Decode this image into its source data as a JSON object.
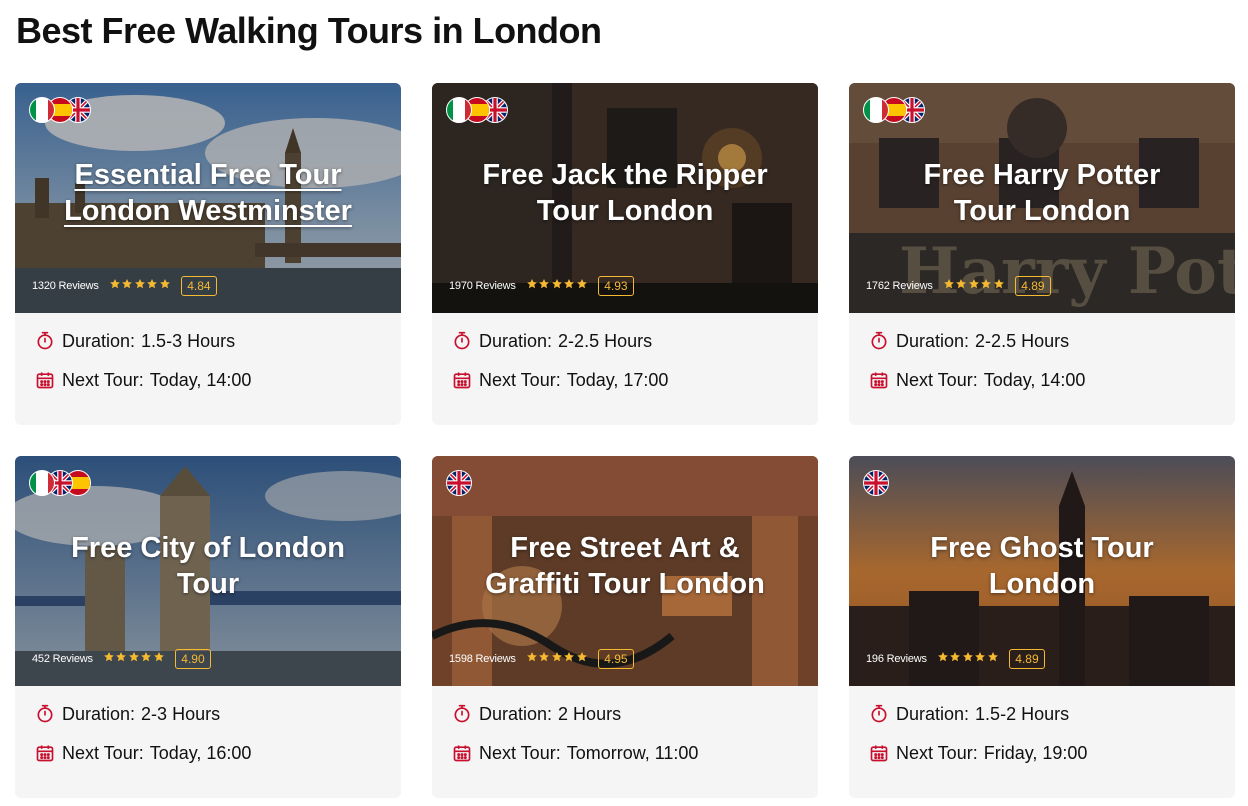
{
  "page_title": "Best Free Walking Tours in London",
  "colors": {
    "accent_red": "#c8102e",
    "rating_gold": "#f5b932",
    "card_bg": "#f5f5f5"
  },
  "labels": {
    "duration": "Duration:",
    "next_tour": "Next Tour:"
  },
  "tours": [
    {
      "title": "Essential Free Tour London Westminster",
      "underlined": true,
      "flags": [
        "italy-flag-icon",
        "spain-flag-icon",
        "uk-flag-icon"
      ],
      "reviews": "1320 Reviews",
      "rating": "4.84",
      "duration": "1.5-3 Hours",
      "next_tour": "Today, 14:00",
      "scene": "westminster"
    },
    {
      "title": "Free Jack the Ripper Tour London",
      "underlined": false,
      "flags": [
        "italy-flag-icon",
        "spain-flag-icon",
        "uk-flag-icon"
      ],
      "reviews": "1970 Reviews",
      "rating": "4.93",
      "duration": "2-2.5 Hours",
      "next_tour": "Today, 17:00",
      "scene": "ripper"
    },
    {
      "title": "Free Harry Potter Tour London",
      "underlined": false,
      "flags": [
        "italy-flag-icon",
        "spain-flag-icon",
        "uk-flag-icon"
      ],
      "reviews": "1762 Reviews",
      "rating": "4.89",
      "duration": "2-2.5 Hours",
      "next_tour": "Today, 14:00",
      "scene": "potter"
    },
    {
      "title": "Free City of London Tour",
      "underlined": false,
      "flags": [
        "italy-flag-icon",
        "uk-flag-icon",
        "spain-flag-icon"
      ],
      "reviews": "452 Reviews",
      "rating": "4.90",
      "duration": "2-3 Hours",
      "next_tour": "Today, 16:00",
      "scene": "towerbridge"
    },
    {
      "title": "Free Street Art & Graffiti Tour London",
      "underlined": false,
      "flags": [
        "uk-flag-icon"
      ],
      "reviews": "1598 Reviews",
      "rating": "4.95",
      "duration": "2 Hours",
      "next_tour": "Tomorrow, 11:00",
      "scene": "graffiti"
    },
    {
      "title": "Free Ghost Tour London",
      "underlined": false,
      "flags": [
        "uk-flag-icon"
      ],
      "reviews": "196 Reviews",
      "rating": "4.89",
      "duration": "1.5-2 Hours",
      "next_tour": "Friday, 19:00",
      "scene": "ghost"
    }
  ]
}
